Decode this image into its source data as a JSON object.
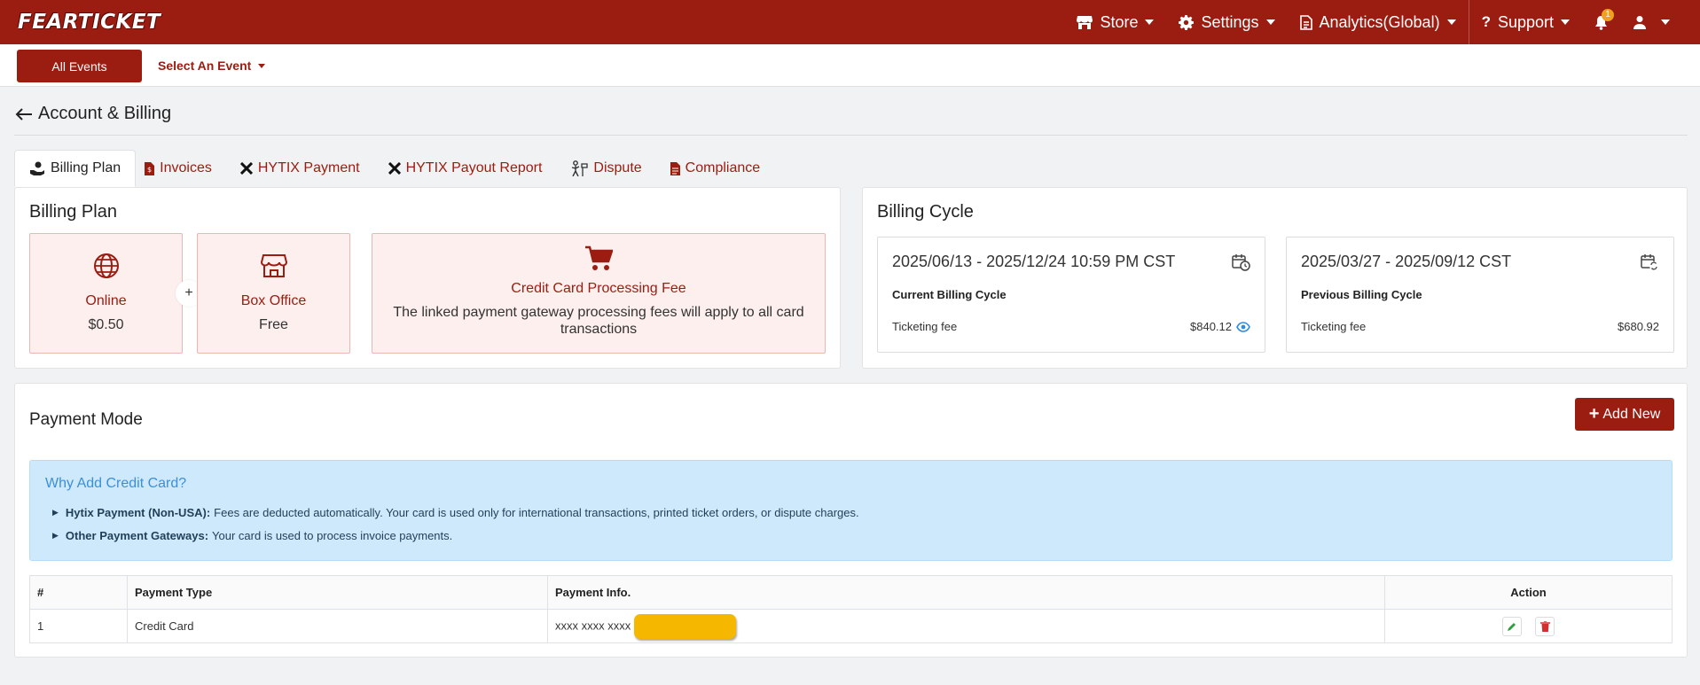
{
  "brand": "FEARTICKET",
  "topnav": {
    "store": "Store",
    "settings": "Settings",
    "analytics": "Analytics(Global)",
    "support": "Support",
    "notification_count": "1"
  },
  "subbar": {
    "all_events": "All Events",
    "select_event": "Select An Event"
  },
  "page_title": "Account & Billing",
  "tabs": [
    {
      "label": "Billing Plan"
    },
    {
      "label": "Invoices"
    },
    {
      "label": "HYTIX Payment"
    },
    {
      "label": "HYTIX Payout Report"
    },
    {
      "label": "Dispute"
    },
    {
      "label": "Compliance"
    }
  ],
  "billing_plan": {
    "title": "Billing Plan",
    "online": {
      "label": "Online",
      "value": "$0.50"
    },
    "plus": "+",
    "box_office": {
      "label": "Box Office",
      "value": "Free"
    },
    "card_fee": {
      "label": "Credit Card Processing Fee",
      "description": "The linked payment gateway processing fees will apply to all card transactions"
    }
  },
  "billing_cycle": {
    "title": "Billing Cycle",
    "current": {
      "range": "2025/06/13 - 2025/12/24 10:59 PM CST",
      "name": "Current Billing Cycle",
      "fee_label": "Ticketing fee",
      "fee_value": "$840.12"
    },
    "previous": {
      "range": "2025/03/27 - 2025/09/12 CST",
      "name": "Previous Billing Cycle",
      "fee_label": "Ticketing fee",
      "fee_value": "$680.92"
    }
  },
  "payment_mode": {
    "title": "Payment Mode",
    "add_new": "Add New",
    "info": {
      "title": "Why Add Credit Card?",
      "line1_bold": "Hytix Payment (Non-USA):",
      "line1_text": "Fees are deducted automatically. Your card is used only for international transactions, printed ticket orders, or dispute charges.",
      "line2_bold": "Other Payment Gateways:",
      "line2_text": "Your card is used to process invoice payments."
    },
    "table": {
      "headers": [
        "#",
        "Payment Type",
        "Payment Info.",
        "Action"
      ],
      "rows": [
        {
          "num": "1",
          "type": "Credit Card",
          "info": "xxxx xxxx xxxx"
        }
      ]
    }
  },
  "colors": {
    "brand": "#9b1c10",
    "info_bg": "#cfe9fc",
    "plan_bg": "#fcefed"
  }
}
